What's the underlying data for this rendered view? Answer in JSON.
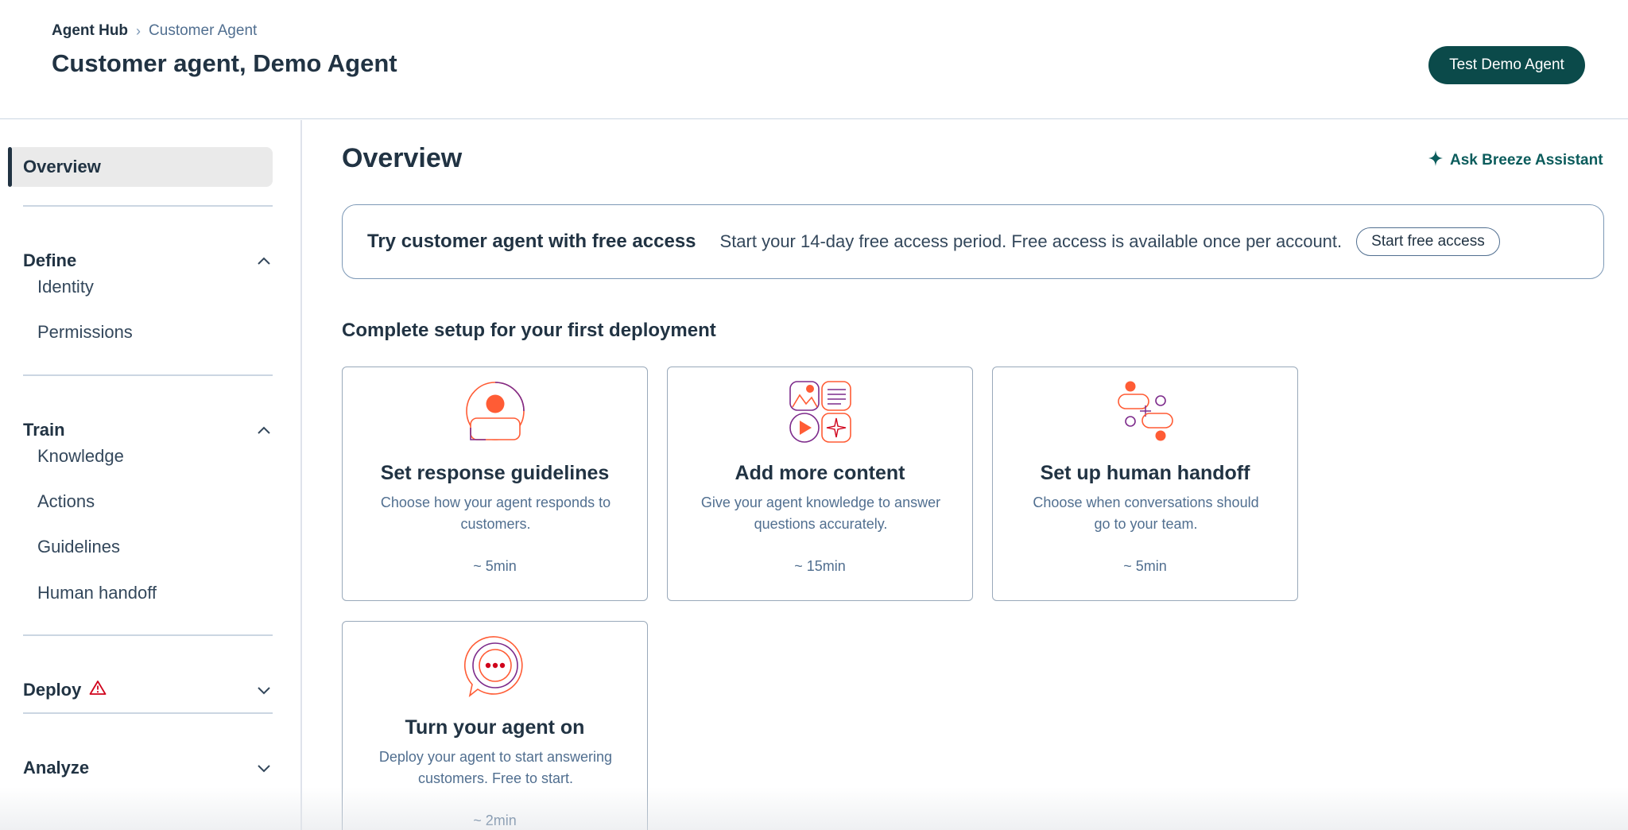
{
  "header": {
    "breadcrumb_root": "Agent Hub",
    "breadcrumb_current": "Customer Agent",
    "title": "Customer agent, Demo Agent",
    "test_button": "Test Demo Agent"
  },
  "sidebar": {
    "overview": "Overview",
    "sections": [
      {
        "label": "Define",
        "items": [
          "Identity",
          "Permissions"
        ]
      },
      {
        "label": "Train",
        "items": [
          "Knowledge",
          "Actions",
          "Guidelines",
          "Human handoff"
        ]
      },
      {
        "label": "Deploy"
      },
      {
        "label": "Analyze"
      }
    ]
  },
  "main": {
    "title": "Overview",
    "ask_link": "Ask Breeze Assistant",
    "banner": {
      "title": "Try customer agent with free access",
      "text": "Start your 14-day free access period. Free access is available once per account.",
      "button": "Start free access"
    },
    "setup_title": "Complete setup for your first deployment",
    "cards": [
      {
        "title": "Set response guidelines",
        "desc": "Choose how your agent responds to customers.",
        "time": "~ 5min",
        "icon": "person-icon"
      },
      {
        "title": "Add more content",
        "desc": "Give your agent knowledge to answer questions accurately.",
        "time": "~ 15min",
        "icon": "content-grid-icon"
      },
      {
        "title": "Set up human handoff",
        "desc": "Choose when conversations should go to your team.",
        "time": "~ 5min",
        "icon": "handoff-flow-icon"
      },
      {
        "title": "Turn your agent on",
        "desc": "Deploy your agent to start answering customers. Free to start.",
        "time": "~ 2min",
        "icon": "chat-bubble-icon"
      }
    ]
  },
  "colors": {
    "primary": "#0b4a4a",
    "accent_orange": "#ff5c35",
    "accent_purple": "#7d2b8b",
    "warning": "#d0021b"
  }
}
